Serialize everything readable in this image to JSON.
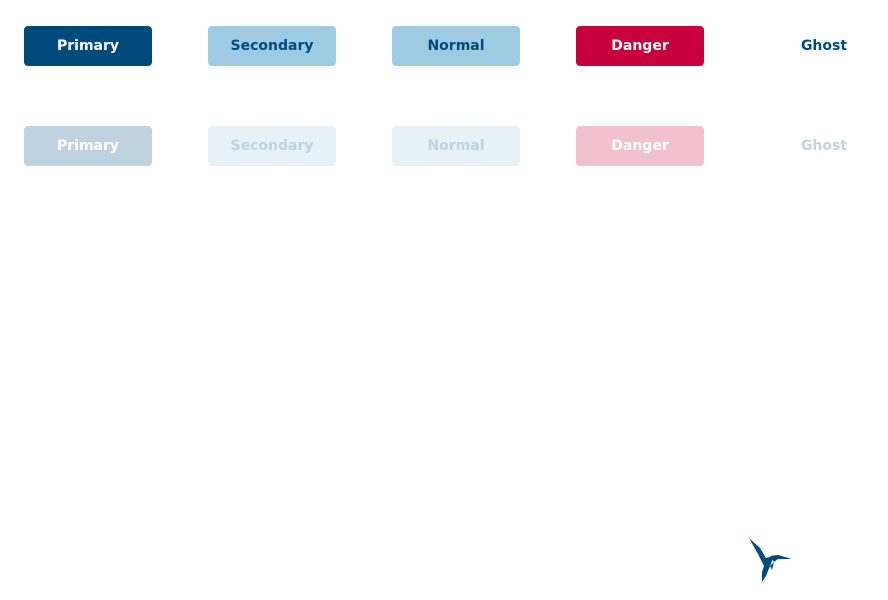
{
  "buttons": {
    "enabled": {
      "primary": "Primary",
      "secondary": "Secondary",
      "normal": "Normal",
      "danger": "Danger",
      "ghost": "Ghost"
    },
    "disabled": {
      "primary": "Primary",
      "secondary": "Secondary",
      "normal": "Normal",
      "danger": "Danger",
      "ghost": "Ghost"
    }
  },
  "colors": {
    "primary": "#004a7c",
    "secondary_bg": "#9ecae3",
    "danger": "#c8003c",
    "logo": "#004a7c"
  },
  "logo": {
    "icon": "hummingbird-logo-icon"
  }
}
